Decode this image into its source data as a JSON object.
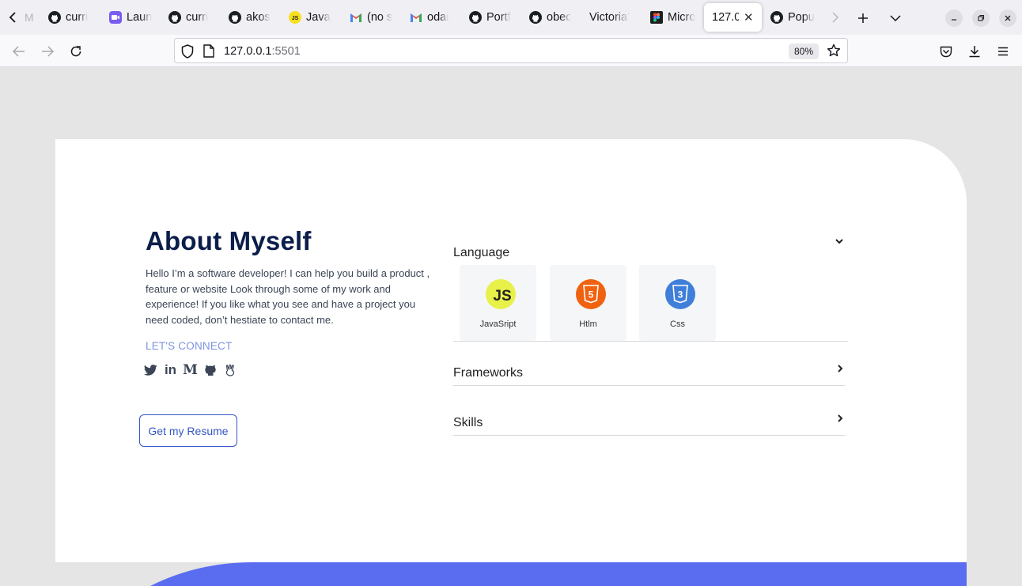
{
  "browser": {
    "tabs": [
      {
        "title": "M",
        "icon": "tab-overflow-fragment"
      },
      {
        "title": "curri",
        "icon": "github-icon"
      },
      {
        "title": "Laun",
        "icon": "zoom-icon"
      },
      {
        "title": "curri",
        "icon": "github-icon"
      },
      {
        "title": "akos",
        "icon": "github-icon"
      },
      {
        "title": "Java",
        "icon": "javascript-icon"
      },
      {
        "title": "(no s",
        "icon": "gmail-icon"
      },
      {
        "title": "odai",
        "icon": "gmail-icon"
      },
      {
        "title": "Portf",
        "icon": "github-icon"
      },
      {
        "title": "obec",
        "icon": "github-icon"
      },
      {
        "title": "Victoria'",
        "icon": "none"
      },
      {
        "title": "Micro",
        "icon": "figma-icon"
      },
      {
        "title": "127.0",
        "icon": "none",
        "active": true
      },
      {
        "title": "Popu",
        "icon": "github-icon"
      }
    ],
    "url_host": "127.0.0.1",
    "url_port": ":5501",
    "zoom": "80%"
  },
  "about": {
    "title": "About Myself",
    "text": "Hello I’m a software developer! I can help you build a product , feature or website Look through some of my work and experience! If you like what you see and have a project you need coded, don’t hestiate to contact me.",
    "connect_label": "LET'S CONNECT",
    "socials": [
      "twitter-icon",
      "linkedin-icon",
      "medium-icon",
      "github-icon",
      "angellist-icon"
    ],
    "social_glyphs": {
      "linkedin": "in",
      "medium": "M"
    },
    "resume_button": "Get my Resume"
  },
  "accordion": {
    "sections": [
      {
        "title": "Language",
        "expanded": true
      },
      {
        "title": "Frameworks",
        "expanded": false
      },
      {
        "title": "Skills",
        "expanded": false
      }
    ],
    "languages": [
      {
        "name": "JavaSript",
        "badge": "JS",
        "color": "#e8f04a"
      },
      {
        "name": "Htlm",
        "badge": "5",
        "color": "#f0620f"
      },
      {
        "name": "Css",
        "badge": "3",
        "color": "#3f7fd9"
      }
    ]
  },
  "colors": {
    "page_bg": "#e5e5e5",
    "heading": "#0b1d4a",
    "accent_link": "#7d93e0",
    "button_border": "#3557c6",
    "footer_band": "#5a6df0"
  }
}
